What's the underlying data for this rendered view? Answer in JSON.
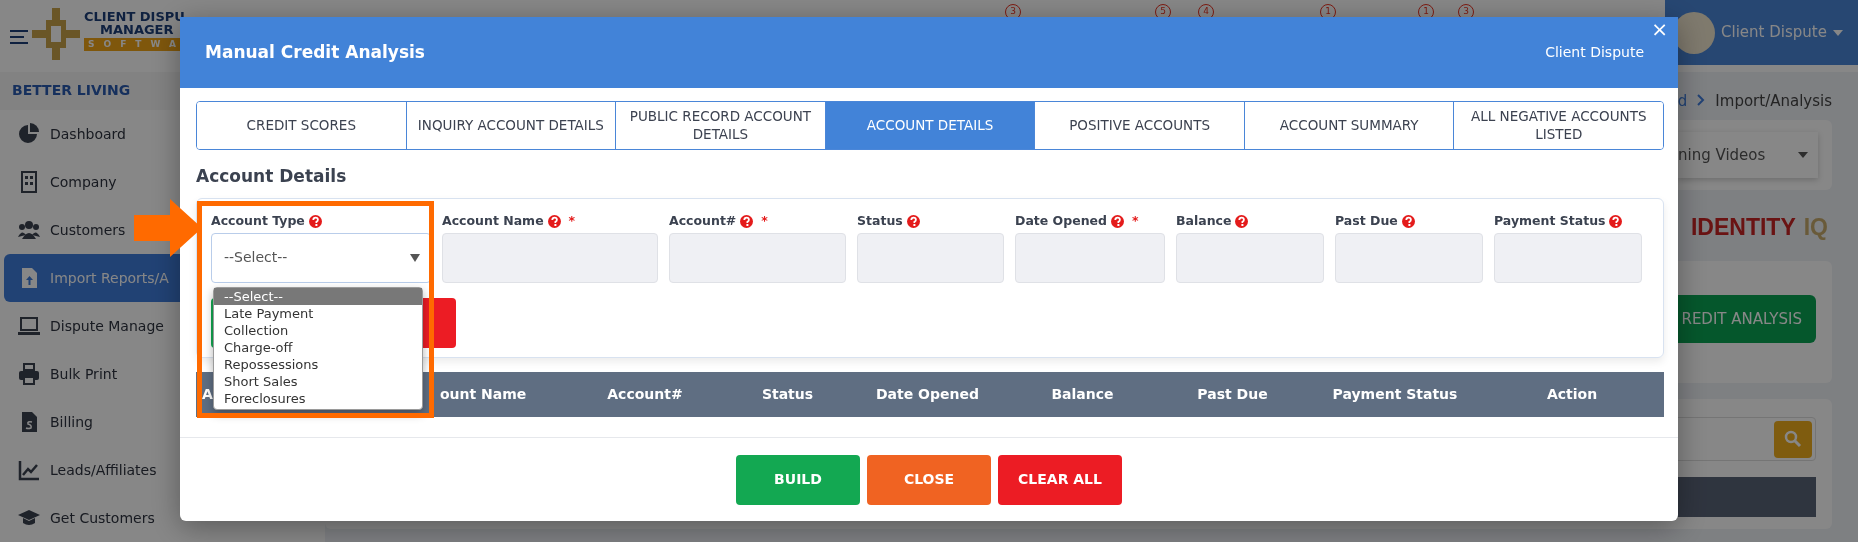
{
  "app": {
    "logo_lines": [
      "CLIENT DISPU",
      "MANAGER",
      "SOFTWA"
    ],
    "org_name": "BETTER LIVING",
    "header_badges": [
      "3",
      "5",
      "4",
      "1",
      "1",
      "3"
    ],
    "user_name": "Client Dispute"
  },
  "sidebar": {
    "items": [
      {
        "label": "Dashboard",
        "selected": false
      },
      {
        "label": "Company",
        "selected": false
      },
      {
        "label": "Customers",
        "selected": false
      },
      {
        "label": "Import Reports/A",
        "selected": true
      },
      {
        "label": "Dispute Manage",
        "selected": false
      },
      {
        "label": "Bulk Print",
        "selected": false
      },
      {
        "label": "Billing",
        "selected": false
      },
      {
        "label": "Leads/Affiliates",
        "selected": false
      },
      {
        "label": "Get Customers",
        "selected": false
      }
    ]
  },
  "page": {
    "breadcrumb": [
      "d",
      "Import/Analysis"
    ],
    "videos_dropdown": "ning Videos",
    "brand_title": [
      "IDENTITY",
      "IQ"
    ],
    "analysis_button": "REDIT ANALYSIS"
  },
  "modal": {
    "title": "Manual Credit Analysis",
    "subtitle": "Client Dispute",
    "close": "×",
    "tabs": [
      {
        "label": "CREDIT SCORES",
        "selected": false
      },
      {
        "label": "INQUIRY ACCOUNT DETAILS",
        "selected": false
      },
      {
        "label": "PUBLIC RECORD ACCOUNT DETAILS",
        "selected": false
      },
      {
        "label": "ACCOUNT DETAILS",
        "selected": true
      },
      {
        "label": "POSITIVE ACCOUNTS",
        "selected": false
      },
      {
        "label": "ACCOUNT SUMMARY",
        "selected": false
      },
      {
        "label": "ALL NEGATIVE ACCOUNTS LISTED",
        "selected": false
      }
    ],
    "section_title": "Account Details",
    "required_mark": "*",
    "fields": [
      {
        "label": "Account Type",
        "kind": "select",
        "value": "--Select--",
        "required": false
      },
      {
        "label": "Account Name",
        "kind": "input",
        "required": true
      },
      {
        "label": "Account#",
        "kind": "input",
        "required": true
      },
      {
        "label": "Status",
        "kind": "input",
        "required": false
      },
      {
        "label": "Date Opened",
        "kind": "input",
        "required": true
      },
      {
        "label": "Balance",
        "kind": "input",
        "required": false
      },
      {
        "label": "Past Due",
        "kind": "input",
        "required": false
      },
      {
        "label": "Payment Status",
        "kind": "input",
        "required": false
      }
    ],
    "dropdown": {
      "options": [
        {
          "label": "--Select--",
          "selected": true
        },
        {
          "label": "Late Payment",
          "selected": false
        },
        {
          "label": "Collection",
          "selected": false
        },
        {
          "label": "Charge-off",
          "selected": false
        },
        {
          "label": "Repossessions",
          "selected": false
        },
        {
          "label": "Short Sales",
          "selected": false
        },
        {
          "label": "Foreclosures",
          "selected": false
        }
      ]
    },
    "table": {
      "columns": [
        "A",
        "ount Name",
        "Account#",
        "Status",
        "Date Opened",
        "Balance",
        "Past Due",
        "Payment Status",
        "Action"
      ]
    },
    "buttons": [
      {
        "label": "BUILD",
        "kind": "success"
      },
      {
        "label": "CLOSE",
        "kind": "warning"
      },
      {
        "label": "CLEAR ALL",
        "kind": "danger"
      }
    ]
  }
}
